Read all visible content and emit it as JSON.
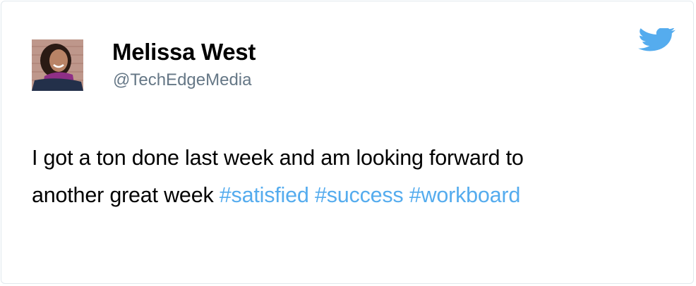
{
  "colors": {
    "accent": "#55acee",
    "text": "#000000",
    "muted": "#657786",
    "border": "#e1e8ed"
  },
  "tweet": {
    "author": {
      "display_name": "Melissa West",
      "handle": "@TechEdgeMedia",
      "avatar_icon": "profile-photo"
    },
    "brand_icon": "twitter-bird-icon",
    "text_line_1": "I got a ton done last week and am looking forward to",
    "text_line_2_prefix": "another great week",
    "hashtags": [
      "#satisfied",
      "#success",
      "#workboard"
    ]
  }
}
